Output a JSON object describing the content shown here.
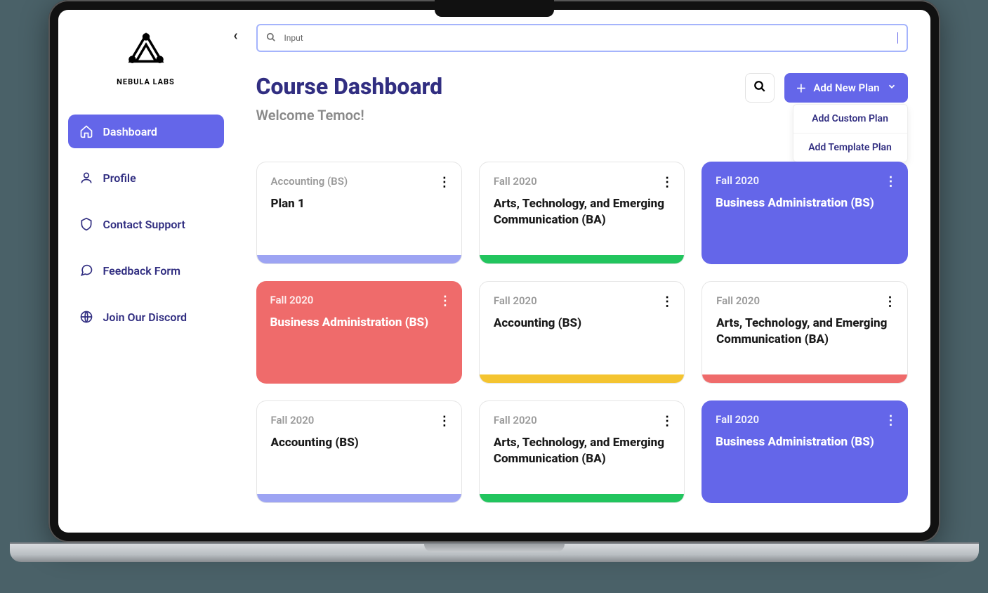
{
  "brand": {
    "name": "NEBULA LABS"
  },
  "search": {
    "value": "Input"
  },
  "sidebar": {
    "items": [
      {
        "label": "Dashboard",
        "icon": "home",
        "active": true
      },
      {
        "label": "Profile",
        "icon": "user",
        "active": false
      },
      {
        "label": "Contact Support",
        "icon": "shield",
        "active": false
      },
      {
        "label": "Feedback Form",
        "icon": "chat",
        "active": false
      },
      {
        "label": "Join Our Discord",
        "icon": "globe",
        "active": false
      }
    ]
  },
  "header": {
    "title": "Course Dashboard",
    "welcome": "Welcome Temoc!",
    "addButton": "Add New Plan",
    "dropdown": [
      {
        "label": "Add Custom Plan"
      },
      {
        "label": "Add Template Plan"
      }
    ]
  },
  "plans": [
    {
      "semester": "Accounting (BS)",
      "title": "Plan  1",
      "variant": "white",
      "strip": "indigo"
    },
    {
      "semester": "Fall 2020",
      "title": "Arts, Technology, and Emerging Communication (BA)",
      "variant": "white",
      "strip": "green"
    },
    {
      "semester": "Fall 2020",
      "title": "Business Administration (BS)",
      "variant": "fill-indigo",
      "strip": ""
    },
    {
      "semester": "Fall 2020",
      "title": "Business Administration (BS)",
      "variant": "fill-red",
      "strip": ""
    },
    {
      "semester": "Fall 2020",
      "title": "Accounting (BS)",
      "variant": "white",
      "strip": "yellow"
    },
    {
      "semester": "Fall 2020",
      "title": "Arts, Technology, and Emerging Communication (BA)",
      "variant": "white",
      "strip": "red"
    },
    {
      "semester": "Fall 2020",
      "title": "Accounting (BS)",
      "variant": "white",
      "strip": "indigo"
    },
    {
      "semester": "Fall 2020",
      "title": "Arts, Technology, and Emerging Communication (BA)",
      "variant": "white",
      "strip": "green"
    },
    {
      "semester": "Fall 2020",
      "title": "Business Administration (BS)",
      "variant": "fill-indigo",
      "strip": ""
    }
  ]
}
